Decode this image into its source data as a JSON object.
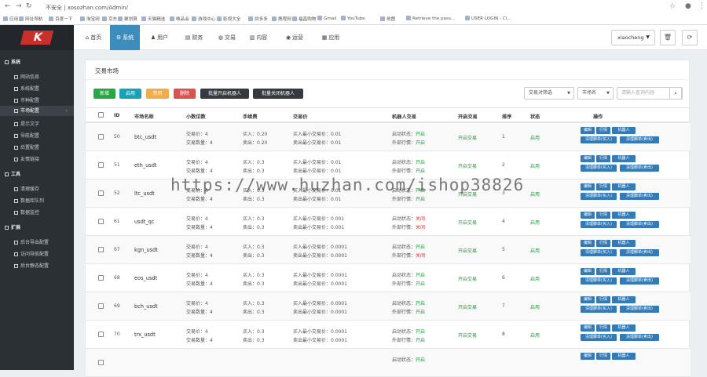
{
  "browser": {
    "security": "不安全",
    "url": "xosozhan.com/Admin/",
    "bookmarks": [
      "应用",
      "网址导航",
      "百度一下",
      "淘宝网",
      "京东",
      "聚划算",
      "天猫精选",
      "唯品会",
      "游戏中心",
      "影视大全",
      "拼多多",
      "携程网",
      "福昌购物",
      "Gmail",
      "YouTube",
      "地图",
      "Retrieve the pass...",
      "USER LOGIN - Cl..."
    ]
  },
  "logo": "K",
  "sidebar": {
    "sections": [
      {
        "label": "系统",
        "items": [
          "网站信息",
          "系统配置",
          "币种配置",
          "市场配置",
          "提示文字",
          "导航配置",
          "后置配置",
          "友情链接"
        ]
      },
      {
        "label": "工具",
        "items": [
          "清理缓存",
          "数据库队列",
          "数据监控"
        ]
      },
      {
        "label": "扩展",
        "items": [
          "后台导出配置",
          "访问导航配置",
          "后台静态配置"
        ]
      }
    ],
    "active_item": "市场配置"
  },
  "topnav": {
    "tabs": [
      "首页",
      "系统",
      "用户",
      "财务",
      "交易",
      "内容",
      "运营",
      "应用"
    ],
    "active_tab": "系统",
    "username": "xiaocheng"
  },
  "page": {
    "title": "交易市场",
    "buttons": [
      "新增",
      "启用",
      "禁用",
      "删除",
      "批量开启机器人",
      "批量关闭机器人"
    ],
    "filter_select": "交易对筛选",
    "filter_market": "市场名",
    "search_placeholder": "请输入查询内容"
  },
  "table": {
    "headers": [
      "ID",
      "市场名称",
      "小数位数",
      "手续费",
      "交易价",
      "机器人交易",
      "开启交易",
      "排序",
      "状态",
      "操作"
    ],
    "rows": [
      {
        "id": "50",
        "name": "btc_usdt",
        "dec_price": "交易价：4",
        "dec_amount": "交易数量：4",
        "fee_buy": "买入：0.20",
        "fee_sell": "卖出：0.20",
        "min_buy": "买入最小交易价：0.01",
        "min_sell": "卖出最小交易价：0.01",
        "robot": "启动状态：开启",
        "robot_ext": "外部行情：开启",
        "trade": "开启交易",
        "sort": "1",
        "status": "启用",
        "buttons": [
          "编辑",
          "行情",
          "机器人",
          "清理脚单(买入)",
          "清理脚单(卖出)"
        ]
      },
      {
        "id": "51",
        "name": "eth_usdt",
        "dec_price": "交易价：4",
        "dec_amount": "交易数量：4",
        "fee_buy": "买入：0.3",
        "fee_sell": "卖出：0.3",
        "min_buy": "买入最小交易价：0.01",
        "min_sell": "卖出最小交易价：0.01",
        "robot": "启动状态：开启",
        "robot_ext": "外部行情：开启",
        "trade": "开启交易",
        "sort": "2",
        "status": "启用",
        "buttons": [
          "编辑",
          "行情",
          "机器人",
          "清理脚单(买入)",
          "清理脚单(卖出)"
        ]
      },
      {
        "id": "52",
        "name": "ltc_usdt",
        "dec_price": "交易价：4",
        "dec_amount": "交易数量：4",
        "fee_buy": "买入：0.3",
        "fee_sell": "卖出：0.3",
        "min_buy": "买入最小交易价：0.01",
        "min_sell": "卖出最小交易价：0.01",
        "robot": "启动状态：开启",
        "robot_ext": "外部行情：开启",
        "trade": "开启交易",
        "sort": "3",
        "status": "启用",
        "buttons": [
          "编辑",
          "行情",
          "机器人",
          "清理脚单(买入)",
          "清理脚单(卖出)"
        ]
      },
      {
        "id": "61",
        "name": "usdt_qc",
        "dec_price": "交易价：4",
        "dec_amount": "交易数量：4",
        "fee_buy": "买入：0.3",
        "fee_sell": "卖出：0.3",
        "min_buy": "买入最小交易价：0.001",
        "min_sell": "卖出最小交易价：0.001",
        "robot": "启动状态：关闭",
        "robot_ext": "外部行情：关闭",
        "trade": "开启交易",
        "sort": "4",
        "status": "启用",
        "buttons": [
          "编辑",
          "行情",
          "机器人",
          "清理脚单(买入)",
          "清理脚单(卖出)"
        ]
      },
      {
        "id": "67",
        "name": "kgn_usdt",
        "dec_price": "交易价：4",
        "dec_amount": "交易数量：4",
        "fee_buy": "买入：0.3",
        "fee_sell": "卖出：0.3",
        "min_buy": "买入最小交易价：0.0001",
        "min_sell": "卖出最小交易价：0.0001",
        "robot": "启动状态：开启",
        "robot_ext": "外部行情：关闭",
        "trade": "开启交易",
        "sort": "5",
        "status": "启用",
        "buttons": [
          "编辑",
          "行情",
          "机器人",
          "清理脚单(买入)",
          "清理脚单(卖出)"
        ]
      },
      {
        "id": "68",
        "name": "eos_usdt",
        "dec_price": "交易价：4",
        "dec_amount": "交易数量：4",
        "fee_buy": "买入：0.3",
        "fee_sell": "卖出：0.3",
        "min_buy": "买入最小交易价：0.0001",
        "min_sell": "卖出最小交易价：0.0001",
        "robot": "启动状态：开启",
        "robot_ext": "外部行情：开启",
        "trade": "开启交易",
        "sort": "6",
        "status": "启用",
        "buttons": [
          "编辑",
          "行情",
          "机器人",
          "清理脚单(买入)",
          "清理脚单(卖出)"
        ]
      },
      {
        "id": "69",
        "name": "bch_usdt",
        "dec_price": "交易价：4",
        "dec_amount": "交易数量：4",
        "fee_buy": "买入：0.3",
        "fee_sell": "卖出：0.3",
        "min_buy": "买入最小交易价：0.0001",
        "min_sell": "卖出最小交易价：0.0001",
        "robot": "启动状态：开启",
        "robot_ext": "外部行情：开启",
        "trade": "开启交易",
        "sort": "7",
        "status": "启用",
        "buttons": [
          "编辑",
          "行情",
          "机器人",
          "清理脚单(买入)",
          "清理脚单(卖出)"
        ]
      },
      {
        "id": "70",
        "name": "trx_usdt",
        "dec_price": "交易价：4",
        "dec_amount": "交易数量：4",
        "fee_buy": "买入：0.3",
        "fee_sell": "卖出：0.3",
        "min_buy": "买入最小交易价：0.0001",
        "min_sell": "卖出最小交易价：0.0001",
        "robot": "启动状态：开启",
        "robot_ext": "外部行情：开启",
        "trade": "开启交易",
        "sort": "8",
        "status": "启用",
        "buttons": [
          "编辑",
          "行情",
          "机器人",
          "清理脚单(买入)",
          "清理脚单(卖出)"
        ]
      },
      {
        "id": "",
        "name": "",
        "dec_price": "",
        "dec_amount": "",
        "fee_buy": "",
        "fee_sell": "",
        "min_buy": "",
        "min_sell": "",
        "robot": "启动状态：开启",
        "robot_ext": "",
        "trade": "",
        "sort": "",
        "status": "",
        "buttons": [
          "编辑",
          "行情",
          "机器人"
        ]
      }
    ]
  },
  "watermark": "https://www.huzhan.com/ishop38826",
  "colors": {
    "primary": "#3c8dbc",
    "success": "#28a745",
    "info": "#17a2b8",
    "warning": "#f0ad4e",
    "danger": "#d9534f",
    "dark": "#343a40",
    "op_button": "#337ab7"
  }
}
